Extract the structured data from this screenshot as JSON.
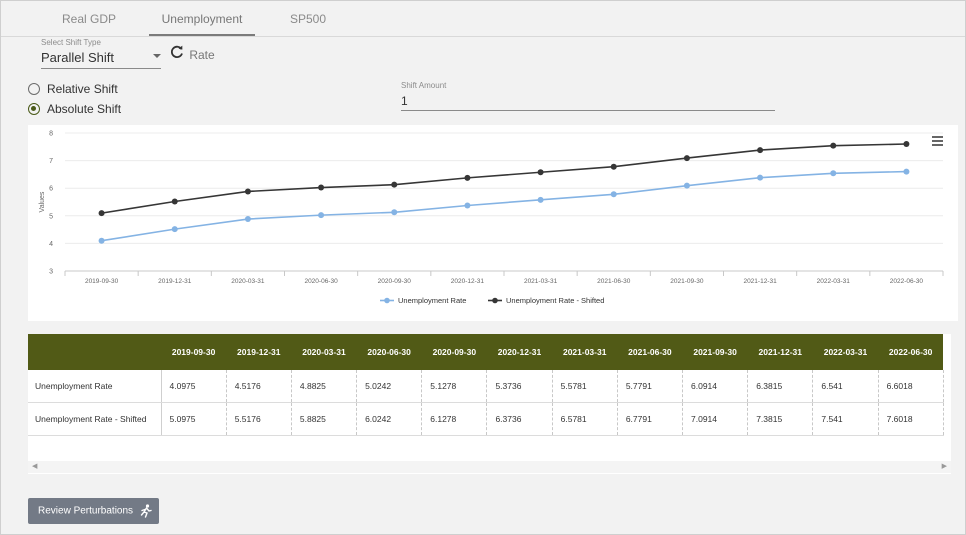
{
  "tabs": [
    {
      "label": "Real GDP"
    },
    {
      "label": "Unemployment Rate",
      "active": true
    },
    {
      "label": "SP500"
    }
  ],
  "shift_type": {
    "label": "Select Shift Type",
    "value": "Parallel Shift"
  },
  "radios": {
    "relative": {
      "label": "Relative Shift",
      "checked": false
    },
    "absolute": {
      "label": "Absolute Shift",
      "checked": true
    }
  },
  "shift_amount": {
    "label": "Shift Amount",
    "value": "1"
  },
  "colors": {
    "accent": "#515a16",
    "series1": "#84b3e4",
    "series2": "#363636"
  },
  "chart_data": {
    "type": "line",
    "title": "",
    "xlabel": "",
    "ylabel": "Values",
    "ylim": [
      3,
      8
    ],
    "yticks": [
      "3",
      "4",
      "5",
      "6",
      "7",
      "8"
    ],
    "categories": [
      "2019-09-30",
      "2019-12-31",
      "2020-03-31",
      "2020-06-30",
      "2020-09-30",
      "2020-12-31",
      "2021-03-31",
      "2021-06-30",
      "2021-09-30",
      "2021-12-31",
      "2022-03-31",
      "2022-06-30"
    ],
    "series": [
      {
        "name": "Unemployment Rate",
        "values": [
          4.0975,
          4.5176,
          4.8825,
          5.0242,
          5.1278,
          5.3736,
          5.5781,
          5.7791,
          6.0914,
          6.3815,
          6.541,
          6.6018
        ]
      },
      {
        "name": "Unemployment Rate - Shifted",
        "values": [
          5.0975,
          5.5176,
          5.8825,
          6.0242,
          6.1278,
          6.3736,
          6.5781,
          6.7791,
          7.0914,
          7.3815,
          7.541,
          7.6018
        ]
      }
    ],
    "legend_position": "bottom-center",
    "grid": true
  },
  "table": {
    "columns": [
      "2019-09-30",
      "2019-12-31",
      "2020-03-31",
      "2020-06-30",
      "2020-09-30",
      "2020-12-31",
      "2021-03-31",
      "2021-06-30",
      "2021-09-30",
      "2021-12-31",
      "2022-03-31",
      "2022-06-30"
    ],
    "rows": [
      {
        "name": "Unemployment Rate",
        "cells": [
          "4.0975",
          "4.5176",
          "4.8825",
          "5.0242",
          "5.1278",
          "5.3736",
          "5.5781",
          "5.7791",
          "6.0914",
          "6.3815",
          "6.541",
          "6.6018"
        ]
      },
      {
        "name": "Unemployment Rate - Shifted",
        "cells": [
          "5.0975",
          "5.5176",
          "5.8825",
          "6.0242",
          "6.1278",
          "6.3736",
          "6.5781",
          "6.7791",
          "7.0914",
          "7.3815",
          "7.541",
          "7.6018"
        ]
      }
    ]
  },
  "review_button": {
    "label": "Review Perturbations",
    "icon": "runner-icon"
  }
}
